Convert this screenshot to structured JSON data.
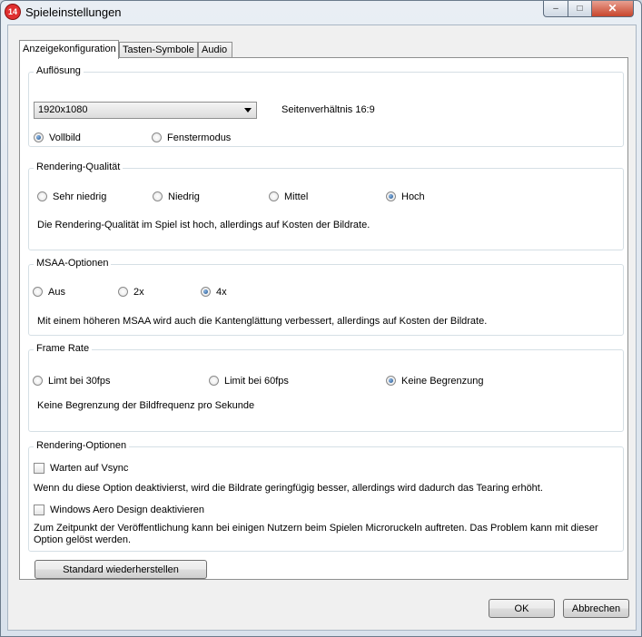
{
  "window": {
    "title": "Spieleinstellungen",
    "icon_text": "14",
    "minimize": "–",
    "maximize": "□",
    "close": "✕"
  },
  "tabs": [
    {
      "label": "Anzeigekonfiguration",
      "active": true
    },
    {
      "label": "Tasten-Symbole",
      "active": false
    },
    {
      "label": "Audio",
      "active": false
    }
  ],
  "resolution": {
    "title": "Auflösung",
    "selected": "1920x1080",
    "aspect": "Seitenverhältnis 16:9",
    "modes": [
      {
        "label": "Vollbild",
        "selected": true
      },
      {
        "label": "Fenstermodus",
        "selected": false
      }
    ]
  },
  "quality": {
    "title": "Rendering-Qualität",
    "options": [
      {
        "label": "Sehr niedrig",
        "selected": false
      },
      {
        "label": "Niedrig",
        "selected": false
      },
      {
        "label": "Mittel",
        "selected": false
      },
      {
        "label": "Hoch",
        "selected": true
      }
    ],
    "description": "Die Rendering-Qualität im Spiel ist hoch, allerdings auf Kosten der Bildrate."
  },
  "msaa": {
    "title": "MSAA-Optionen",
    "options": [
      {
        "label": "Aus",
        "selected": false
      },
      {
        "label": "2x",
        "selected": false
      },
      {
        "label": "4x",
        "selected": true
      }
    ],
    "description": "Mit einem höheren MSAA wird auch die Kantenglättung verbessert, allerdings auf Kosten der Bildrate."
  },
  "framerate": {
    "title": "Frame Rate",
    "options": [
      {
        "label": "Limt bei 30fps",
        "selected": false
      },
      {
        "label": "Limit bei 60fps",
        "selected": false
      },
      {
        "label": "Keine Begrenzung",
        "selected": true
      }
    ],
    "description": "Keine Begrenzung der Bildfrequenz pro Sekunde"
  },
  "rendering_options": {
    "title": "Rendering-Optionen",
    "vsync": {
      "label": "Warten auf Vsync",
      "checked": false,
      "description": "Wenn du diese Option deaktivierst, wird die Bildrate geringfügig besser, allerdings wird dadurch das Tearing erhöht."
    },
    "aero": {
      "label": "Windows Aero Design deaktivieren",
      "checked": false,
      "description_line1": "Zum Zeitpunkt der Veröffentlichung kann bei einigen Nutzern beim Spielen Microruckeln auftreten. Das Problem kann mit dieser",
      "description_line2": "Option gelöst werden."
    }
  },
  "buttons": {
    "restore": "Standard wiederherstellen",
    "ok": "OK",
    "cancel": "Abbrechen"
  },
  "colors": {
    "close_button": "#c8452c",
    "radio_selected": "#1d4f8a",
    "panel_border": "#d5dfe5"
  }
}
